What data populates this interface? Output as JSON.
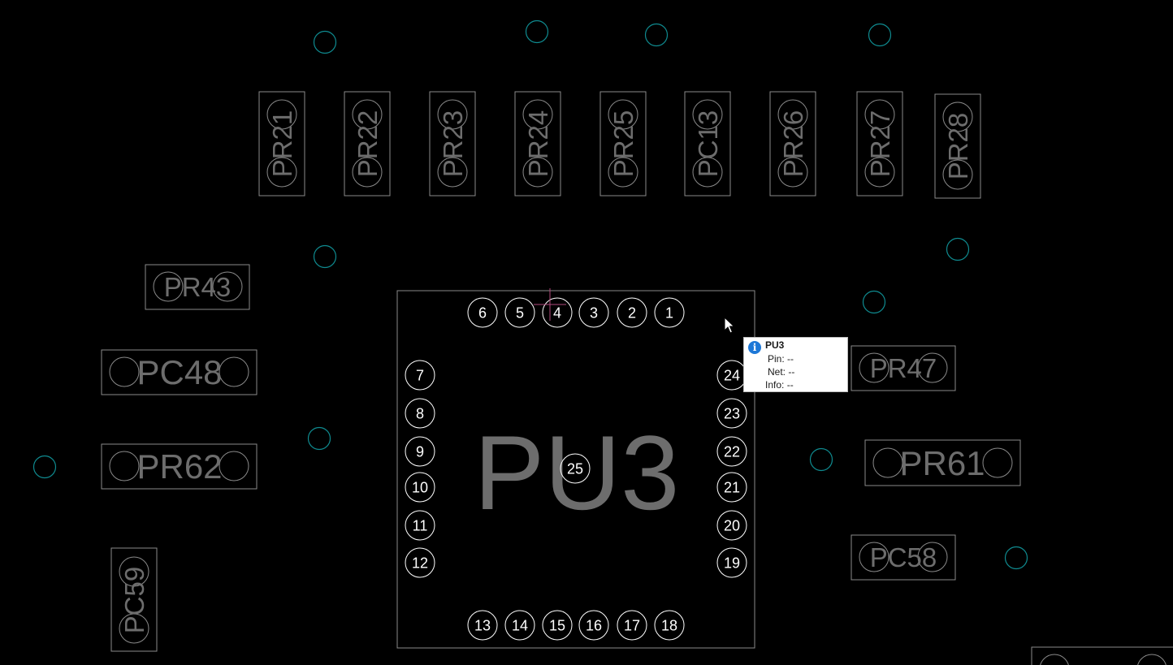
{
  "colors": {
    "background": "#000000",
    "outline": "#8a8a8a",
    "pad": "#ffffff",
    "via": "#0f8a8f",
    "ref_text": "#6d6d6d",
    "crosshair": "#b0487a",
    "tooltip_bg": "#ffffff",
    "tooltip_icon": "#1e78d7"
  },
  "chip": {
    "refdes": "PU3",
    "pins_top": [
      "6",
      "5",
      "4",
      "3",
      "2",
      "1"
    ],
    "pins_left": [
      "7",
      "8",
      "9",
      "10",
      "11",
      "12"
    ],
    "pins_right": [
      "24",
      "23",
      "22",
      "21",
      "20",
      "19"
    ],
    "pins_bottom": [
      "13",
      "14",
      "15",
      "16",
      "17",
      "18"
    ],
    "center_pin": "25"
  },
  "components": {
    "top_row": [
      "PR21",
      "PR22",
      "PR23",
      "PR24",
      "PR25",
      "PC13",
      "PR26",
      "PR27",
      "PR28"
    ],
    "left": [
      "PR43",
      "PC48",
      "PR62",
      "PC59"
    ],
    "right": [
      "PR47",
      "PR61",
      "PC58"
    ]
  },
  "tooltip": {
    "icon": "info-icon",
    "title": "PU3",
    "pin_label": "Pin:",
    "pin_value": "--",
    "net_label": "Net:",
    "net_value": "--",
    "info_label": "Info:",
    "info_value": "--"
  },
  "cursor_icon": "arrow-cursor-icon"
}
